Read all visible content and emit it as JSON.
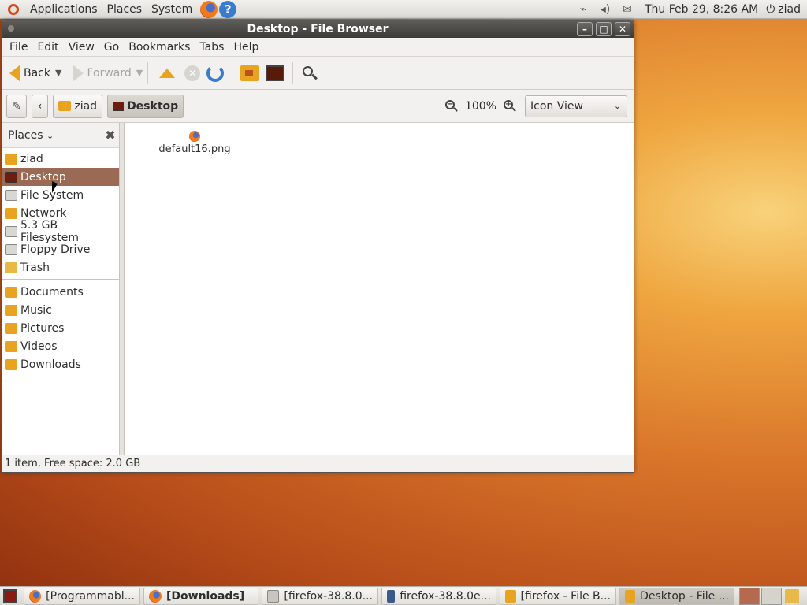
{
  "top_panel": {
    "menus": [
      "Applications",
      "Places",
      "System"
    ],
    "clock": "Thu Feb 29,  8:26 AM",
    "user": "ziad",
    "tray_icons": [
      "network-icon",
      "volume-icon",
      "mail-icon"
    ]
  },
  "window": {
    "title": "Desktop - File Browser",
    "menubar": [
      "File",
      "Edit",
      "View",
      "Go",
      "Bookmarks",
      "Tabs",
      "Help"
    ],
    "toolbar": {
      "back": "Back",
      "forward": "Forward"
    },
    "location": {
      "crumbs": [
        "ziad",
        "Desktop"
      ],
      "zoom": "100%",
      "view_mode": "Icon View"
    },
    "sidebar": {
      "title": "Places",
      "items": [
        "ziad",
        "Desktop",
        "File System",
        "Network",
        "5.3 GB Filesystem",
        "Floppy Drive",
        "Trash"
      ],
      "bookmarks": [
        "Documents",
        "Music",
        "Pictures",
        "Videos",
        "Downloads"
      ],
      "selected": "Desktop"
    },
    "files": [
      {
        "name": "default16.png"
      }
    ],
    "status": "1 item, Free space: 2.0 GB"
  },
  "taskbar": {
    "tasks": [
      {
        "label": "[Programmabl..."
      },
      {
        "label": "[Downloads]"
      },
      {
        "label": "[firefox-38.8.0..."
      },
      {
        "label": "firefox-38.8.0e..."
      },
      {
        "label": "[firefox - File B..."
      },
      {
        "label": "Desktop - File ..."
      }
    ]
  }
}
